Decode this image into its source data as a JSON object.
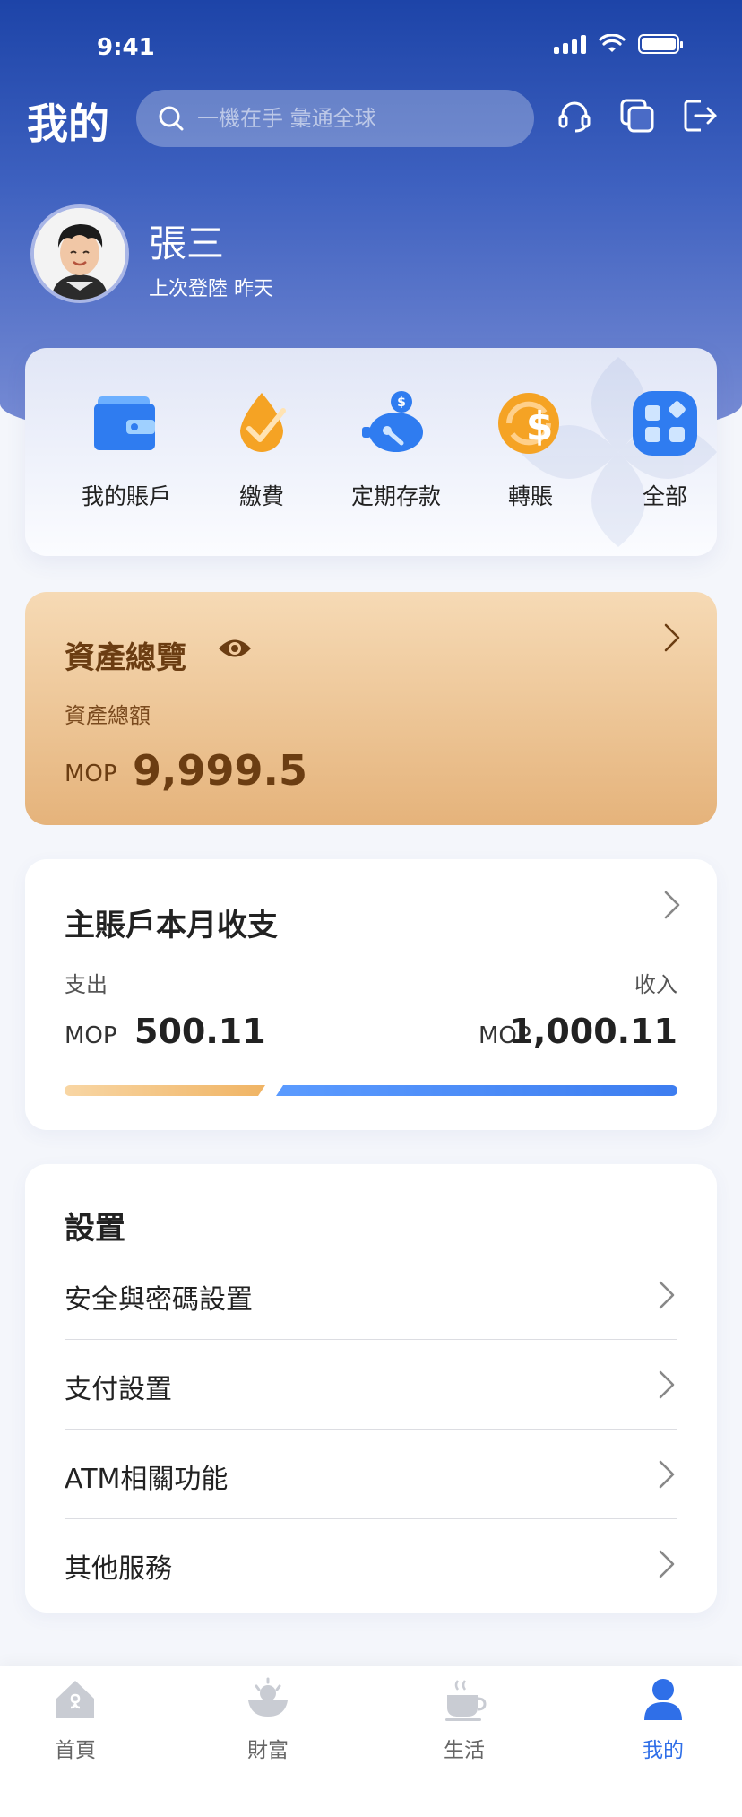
{
  "status_bar": {
    "time": "9:41"
  },
  "header": {
    "title": "我的",
    "search_placeholder": "一機在手 彙通全球"
  },
  "profile": {
    "name": "張三",
    "last_login": "上次登陸 昨天"
  },
  "quick_actions": [
    {
      "label": "我的賬戶",
      "icon": "wallet-icon"
    },
    {
      "label": "繳費",
      "icon": "pay-bill-icon"
    },
    {
      "label": "定期存款",
      "icon": "piggy-bank-icon"
    },
    {
      "label": "轉賬",
      "icon": "transfer-icon"
    },
    {
      "label": "全部",
      "icon": "all-apps-icon"
    }
  ],
  "assets": {
    "title": "資產總覽",
    "total_label": "資產總額",
    "currency": "MOP",
    "total": "9,999.5"
  },
  "monthly": {
    "title": "主賬戶本月收支",
    "expense_label": "支出",
    "income_label": "收入",
    "expense_currency": "MOP",
    "expense_amount": "500.11",
    "income_currency": "MOP",
    "income_amount": "1,000.11",
    "expense_share": 0.333
  },
  "settings": {
    "title": "設置",
    "items": [
      {
        "label": "安全與密碼設置"
      },
      {
        "label": "支付設置"
      },
      {
        "label": "ATM相關功能"
      },
      {
        "label": "其他服務"
      }
    ]
  },
  "tabbar": {
    "items": [
      {
        "label": "首頁",
        "icon": "home-icon"
      },
      {
        "label": "財富",
        "icon": "wealth-icon"
      },
      {
        "label": "生活",
        "icon": "life-coffee-icon"
      },
      {
        "label": "我的",
        "icon": "profile-icon",
        "active": true
      }
    ]
  },
  "colors": {
    "primary": "#2f6fe8",
    "header_blue": "#1d44a8",
    "gold_text": "#6b3d12",
    "expense_bar": "#f0b464",
    "income_bar": "#3d7df0"
  }
}
